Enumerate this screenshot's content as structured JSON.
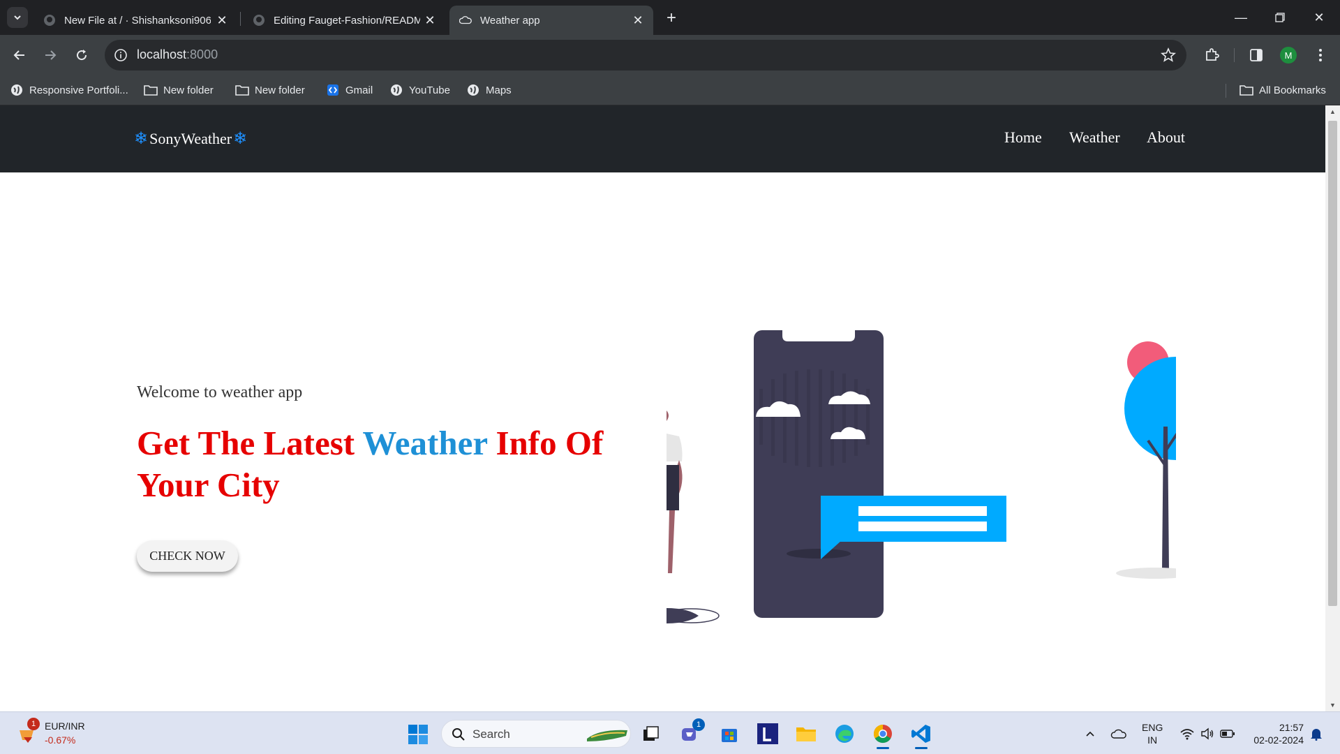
{
  "browser": {
    "tabs": [
      {
        "title": "New File at / · Shishanksoni906/",
        "icon": "github-icon"
      },
      {
        "title": "Editing Fauget-Fashion/READM",
        "icon": "github-icon"
      },
      {
        "title": "Weather app",
        "icon": "weather-cloud-icon",
        "active": true
      }
    ],
    "url_host": "localhost",
    "url_port": ":8000",
    "profile_initial": "M",
    "bookmarks": [
      {
        "label": "Responsive Portfoli...",
        "icon": "globe-icon"
      },
      {
        "label": "New folder",
        "icon": "folder-icon"
      },
      {
        "label": "New folder",
        "icon": "folder-icon"
      },
      {
        "label": "Gmail",
        "icon": "code-icon"
      },
      {
        "label": "YouTube",
        "icon": "globe-icon"
      },
      {
        "label": "Maps",
        "icon": "globe-icon"
      }
    ],
    "all_bookmarks": "All Bookmarks"
  },
  "site": {
    "brand": "SonyWeather",
    "nav": [
      "Home",
      "Weather",
      "About"
    ],
    "hero": {
      "welcome": "Welcome to weather app",
      "headline_part1": "Get The Latest ",
      "headline_accent": "Weather",
      "headline_part2": " Info Of Your City",
      "cta": "CHECK NOW"
    },
    "colors": {
      "nav_bg": "#212529",
      "headline": "#e60000",
      "accent": "#1e90d6",
      "illustration_blue": "#00aaff",
      "phone": "#3f3d56"
    }
  },
  "taskbar": {
    "widget_badge": "1",
    "widget_pair": "EUR/INR",
    "widget_change": "-0.67%",
    "search_label": "Search",
    "teams_badge": "1",
    "lang_top": "ENG",
    "lang_bottom": "IN",
    "time": "21:57",
    "date": "02-02-2024"
  }
}
